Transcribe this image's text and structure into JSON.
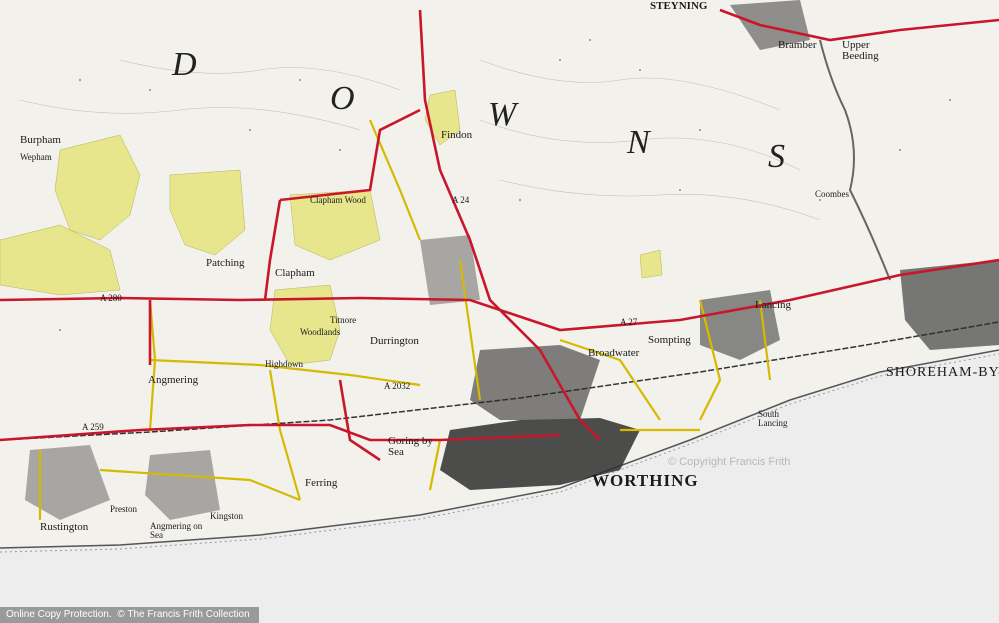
{
  "map": {
    "colors": {
      "land": "#f2f1ec",
      "sea": "#ececec",
      "woodland": "#e6e68a",
      "road_a": "#c8162b",
      "road_b": "#d4b800",
      "urban": "#2b2b2b",
      "coast": "#555555"
    },
    "region_letters": [
      "D",
      "O",
      "W",
      "N",
      "S"
    ],
    "places": {
      "steyning": "STEYNING",
      "bramber": "Bramber",
      "upper_beeding": "Upper Beeding",
      "burpham": "Burpham",
      "wepham": "Wepham",
      "findon": "Findon",
      "patching": "Patching",
      "clapham": "Clapham",
      "clapham_wood": "Clapham Wood",
      "angmering": "Angmering",
      "durrington": "Durrington",
      "sompting": "Sompting",
      "broadwater": "Broadwater",
      "lancing": "Lancing",
      "goring": "Goring by Sea",
      "ferring": "Ferring",
      "kingston": "Kingston",
      "rustington": "Rustington",
      "preston": "Preston",
      "angmering_on_sea": "Angmering on Sea",
      "worthing": "WORTHING",
      "shoreham": "SHOREHAM-BY-",
      "south_lancing": "South Lancing",
      "coombes": "Coombes",
      "titnore": "Titnore",
      "highdown": "Highdown",
      "woodlands": "Woodlands"
    },
    "road_numbers": {
      "a259": "A 259",
      "a280": "A 280",
      "a27": "A 27",
      "a2032": "A 2032",
      "a24": "A 24"
    }
  },
  "watermark": "© Copyright Francis Frith",
  "footer": {
    "online_copy": "Online Copy Protection.",
    "copyright": "© The Francis Frith Collection"
  }
}
